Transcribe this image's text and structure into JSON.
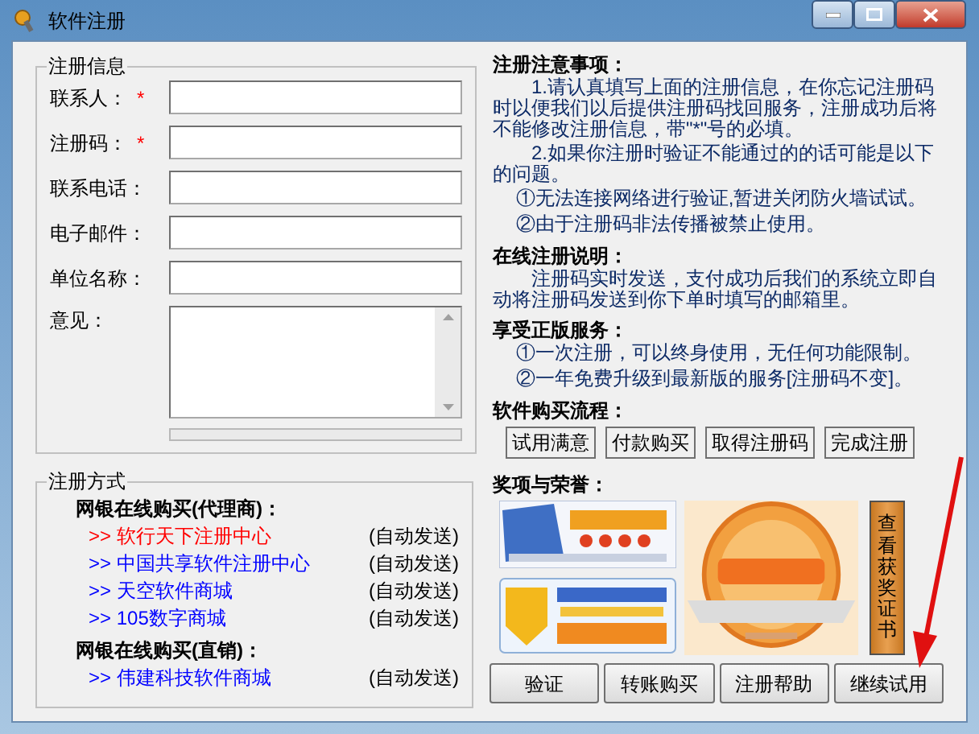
{
  "window": {
    "title": "软件注册"
  },
  "registration_info": {
    "title": "注册信息",
    "fields": [
      {
        "label": "联系人：",
        "required_mark": "*"
      },
      {
        "label": "注册码：",
        "required_mark": "*"
      },
      {
        "label": "联系电话："
      },
      {
        "label": "电子邮件："
      },
      {
        "label": "单位名称："
      }
    ],
    "comments_label": "意见："
  },
  "registration_methods": {
    "title": "注册方式",
    "groups": [
      {
        "heading": "网银在线购买(代理商)：",
        "links": [
          {
            "text": ">> 软行天下注册中心",
            "delivery": "(自动发送)",
            "color": "#ff0000"
          },
          {
            "text": ">> 中国共享软件注册中心",
            "delivery": "(自动发送)",
            "color": "#0000ff"
          },
          {
            "text": ">> 天空软件商城",
            "delivery": "(自动发送)",
            "color": "#0000ff"
          },
          {
            "text": ">> 105数字商城",
            "delivery": "(自动发送)",
            "color": "#0000ff"
          }
        ]
      },
      {
        "heading": "网银在线购买(直销)：",
        "links": [
          {
            "text": ">> 伟建科技软件商城",
            "delivery": "(自动发送)",
            "color": "#0000ff"
          }
        ]
      }
    ]
  },
  "notes": [
    {
      "heading": "注册注意事项：",
      "paragraphs": [
        {
          "text": "1.请认真填写上面的注册信息，在你忘记注册码时以便我们以后提供注册码找回服务，注册成功后将不能修改注册信息，带\"*\"号的必填。",
          "kind": "indented"
        },
        {
          "text": "2.如果你注册时验证不能通过的的话可能是以下的问题。",
          "kind": "indented"
        },
        {
          "text": "①无法连接网络进行验证,暂进关闭防火墙试试。",
          "kind": "item"
        },
        {
          "text": "②由于注册码非法传播被禁止使用。",
          "kind": "item"
        }
      ]
    },
    {
      "heading": "在线注册说明：",
      "paragraphs": [
        {
          "text": "注册码实时发送，支付成功后我们的系统立即自动将注册码发送到你下单时填写的邮箱里。",
          "kind": "indented"
        }
      ]
    },
    {
      "heading": "享受正版服务：",
      "paragraphs": [
        {
          "text": "①一次注册，可以终身使用，无任何功能限制。",
          "kind": "item"
        },
        {
          "text": "②一年免费升级到最新版的服务[注册码不变]。",
          "kind": "item"
        }
      ]
    }
  ],
  "purchase_flow": {
    "heading": "软件购买流程：",
    "steps": [
      "试用满意",
      "付款购买",
      "取得注册码",
      "完成注册"
    ]
  },
  "awards": {
    "heading": "奖项与荣誉：",
    "certificate_button": "查看获奖证书"
  },
  "buttons": [
    "验证",
    "转账购买",
    "注册帮助",
    "继续试用"
  ]
}
